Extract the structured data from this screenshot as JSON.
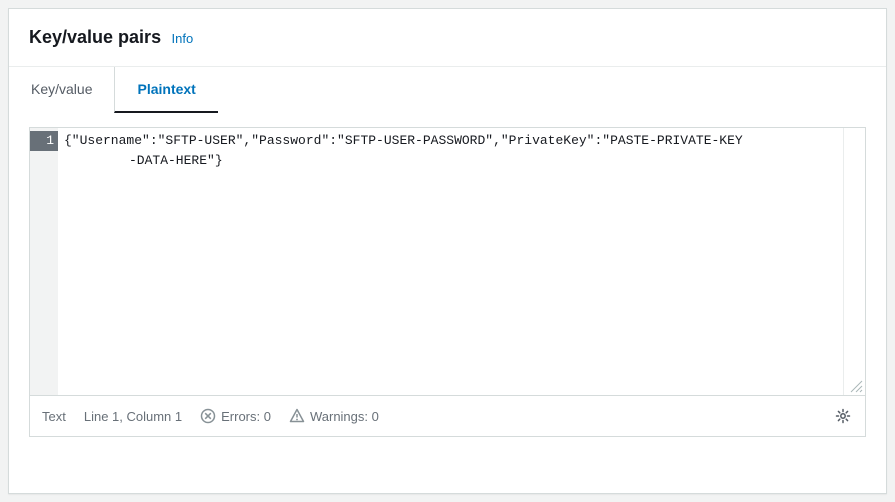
{
  "panel": {
    "title": "Key/value pairs",
    "info_label": "Info"
  },
  "tabs": {
    "items": [
      {
        "label": "Key/value"
      },
      {
        "label": "Plaintext"
      }
    ],
    "active_index": 1
  },
  "editor": {
    "line_number": "1",
    "content_line1": "{\"Username\":\"SFTP-USER\",\"Password\":\"SFTP-USER-PASSWORD\",\"PrivateKey\":\"PASTE-PRIVATE-KEY",
    "content_line2": "-DATA-HERE\"}"
  },
  "statusbar": {
    "mode": "Text",
    "cursor": "Line 1, Column 1",
    "errors_label": "Errors: 0",
    "warnings_label": "Warnings: 0"
  }
}
